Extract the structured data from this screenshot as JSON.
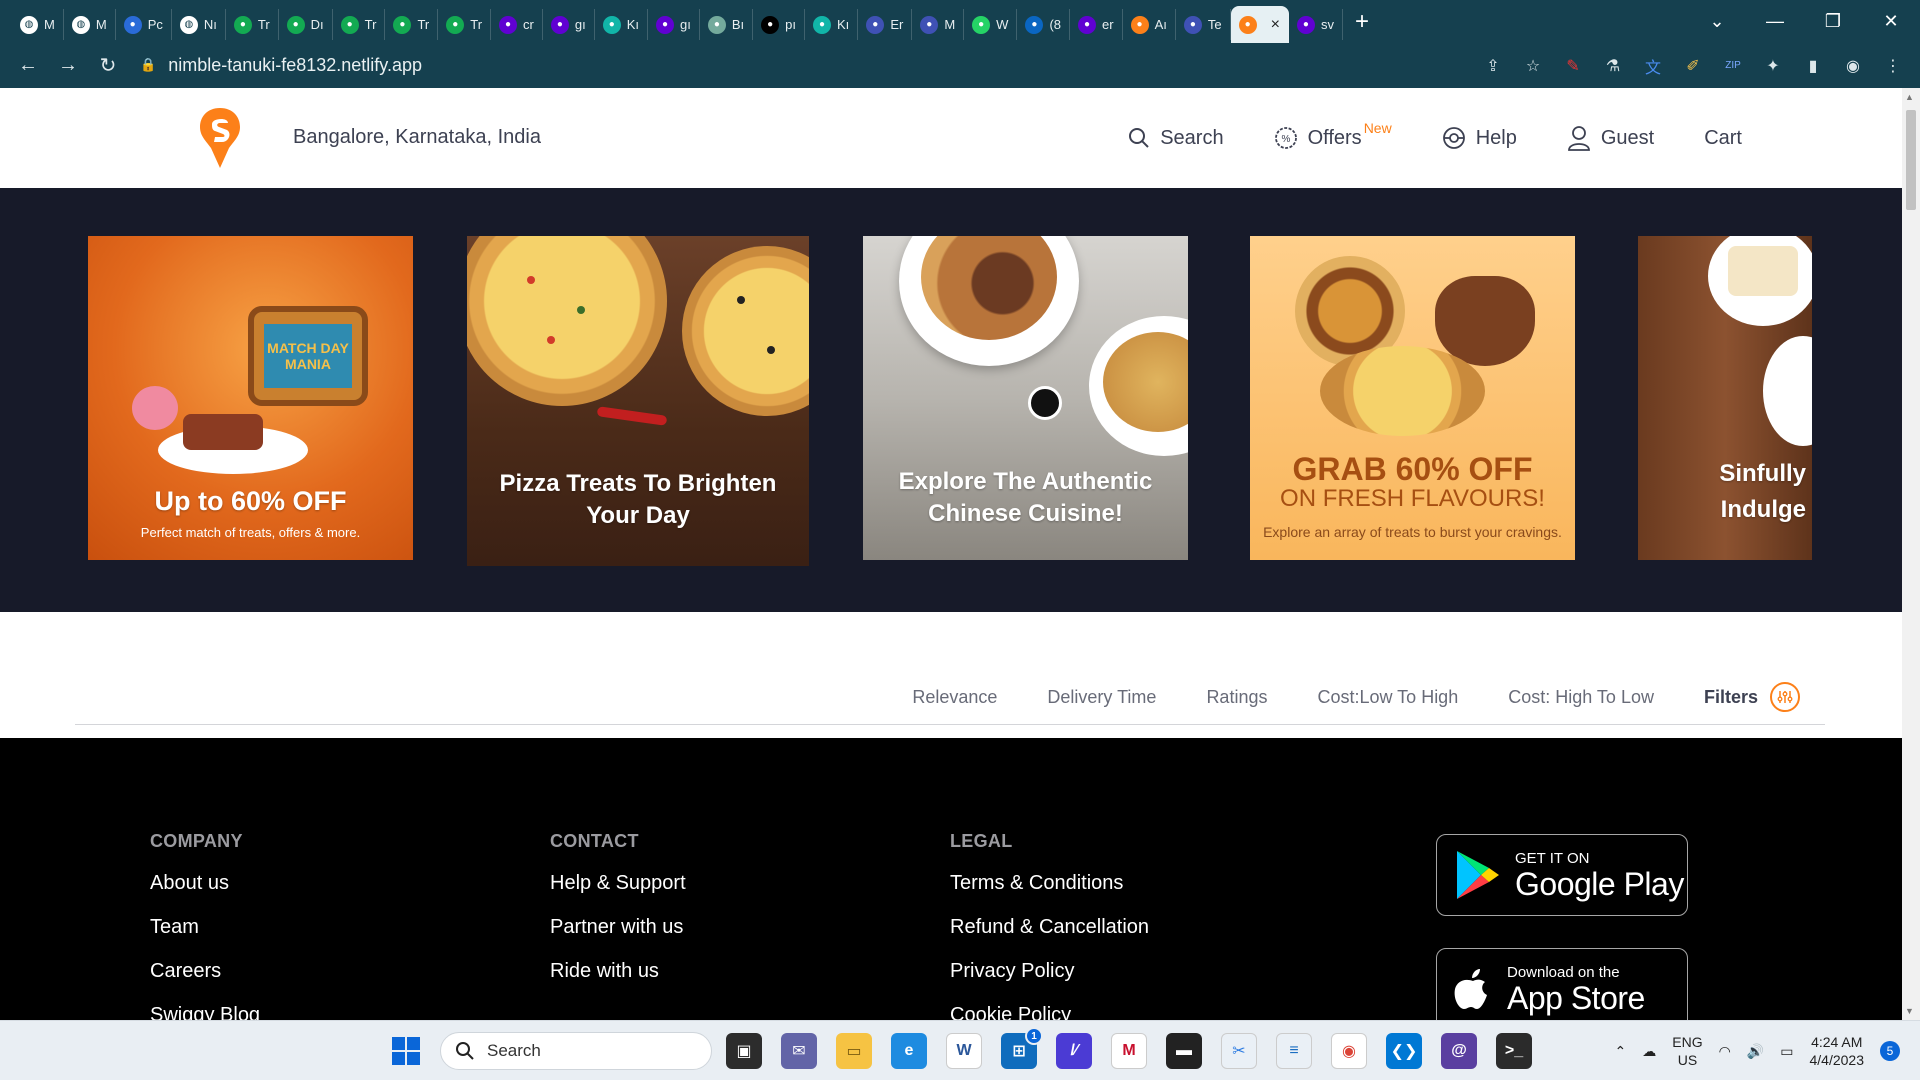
{
  "browser": {
    "tabs": [
      {
        "favicon": "globe-icon",
        "title": "M",
        "color": "#ffffff"
      },
      {
        "favicon": "globe-icon",
        "title": "M",
        "color": "#ffffff"
      },
      {
        "favicon": "zoho-icon",
        "title": "Pc",
        "color": "#2a6bd8"
      },
      {
        "favicon": "globe-icon",
        "title": "Nı",
        "color": "#ffffff"
      },
      {
        "favicon": "leaf-icon",
        "title": "Tr",
        "color": "#13aa52"
      },
      {
        "favicon": "leaf-icon",
        "title": "Dı",
        "color": "#13aa52"
      },
      {
        "favicon": "leaf-icon",
        "title": "Tr",
        "color": "#13aa52"
      },
      {
        "favicon": "leaf-icon",
        "title": "Tr",
        "color": "#13aa52"
      },
      {
        "favicon": "leaf-icon",
        "title": "Tr",
        "color": "#13aa52"
      },
      {
        "favicon": "yahoo-icon",
        "title": "cr",
        "color": "#6001d2"
      },
      {
        "favicon": "yahoo-icon",
        "title": "gı",
        "color": "#6001d2"
      },
      {
        "favicon": "k-icon",
        "title": "Kı",
        "color": "#11b5a8"
      },
      {
        "favicon": "yahoo-icon",
        "title": "gı",
        "color": "#6001d2"
      },
      {
        "favicon": "openai-icon",
        "title": "Bı",
        "color": "#74aa9c"
      },
      {
        "favicon": "notion-icon",
        "title": "pı",
        "color": "#000000"
      },
      {
        "favicon": "k-icon",
        "title": "Kı",
        "color": "#11b5a8"
      },
      {
        "favicon": "send-icon",
        "title": "Er",
        "color": "#3f51b5"
      },
      {
        "favicon": "send-icon",
        "title": "M",
        "color": "#3f51b5"
      },
      {
        "favicon": "whatsapp-icon",
        "title": "W",
        "color": "#25d366"
      },
      {
        "favicon": "linkedin-icon",
        "title": "(8",
        "color": "#0a66c2"
      },
      {
        "favicon": "yahoo-icon",
        "title": "er",
        "color": "#6001d2"
      },
      {
        "favicon": "swiggy-icon",
        "title": "Aı",
        "color": "#fc8019"
      },
      {
        "favicon": "send-icon",
        "title": "Te",
        "color": "#3f51b5"
      },
      {
        "favicon": "swiggy-icon",
        "title": "",
        "color": "#fc8019",
        "active": true
      },
      {
        "favicon": "yahoo-icon",
        "title": "sv",
        "color": "#6001d2"
      }
    ],
    "url": "nimble-tanuki-fe8132.netlify.app"
  },
  "header": {
    "location": "Bangalore, Karnataka, India",
    "nav": {
      "search": "Search",
      "offers": "Offers",
      "offers_badge": "New",
      "help": "Help",
      "guest": "Guest",
      "cart": "Cart"
    }
  },
  "carousel": {
    "cards": [
      {
        "title": "Up to 60% OFF",
        "subtitle": "Perfect match of treats, offers & more.",
        "tv_text": "MATCH DAY MANIA"
      },
      {
        "title": "Pizza Treats To Brighten Your Day"
      },
      {
        "title": "Explore The Authentic Chinese Cuisine!"
      },
      {
        "title": "GRAB 60% OFF",
        "title2": "ON FRESH FLAVOURS!",
        "subtitle": "Explore an array of treats to burst your cravings."
      },
      {
        "title": "Sinfully Indulge"
      }
    ]
  },
  "sort": {
    "options": [
      "Relevance",
      "Delivery Time",
      "Ratings",
      "Cost:Low To High",
      "Cost: High To Low"
    ],
    "filters_label": "Filters"
  },
  "footer": {
    "company": {
      "heading": "COMPANY",
      "links": [
        "About us",
        "Team",
        "Careers",
        "Swiggy Blog"
      ]
    },
    "contact": {
      "heading": "CONTACT",
      "links": [
        "Help & Support",
        "Partner with us",
        "Ride with us"
      ]
    },
    "legal": {
      "heading": "LEGAL",
      "links": [
        "Terms & Conditions",
        "Refund & Cancellation",
        "Privacy Policy",
        "Cookie Policy"
      ]
    },
    "google_play": {
      "small": "GET IT ON",
      "big": "Google Play"
    },
    "app_store": {
      "small": "Download on the",
      "big": "App Store"
    }
  },
  "taskbar": {
    "search_placeholder": "Search",
    "lang": "ENG",
    "region": "US",
    "time": "4:24 AM",
    "date": "4/4/2023",
    "notifications": "5",
    "store_badge": "1"
  },
  "colors": {
    "brand": "#fc8019",
    "chrome": "#15404f",
    "carousel_bg": "#171a29"
  }
}
